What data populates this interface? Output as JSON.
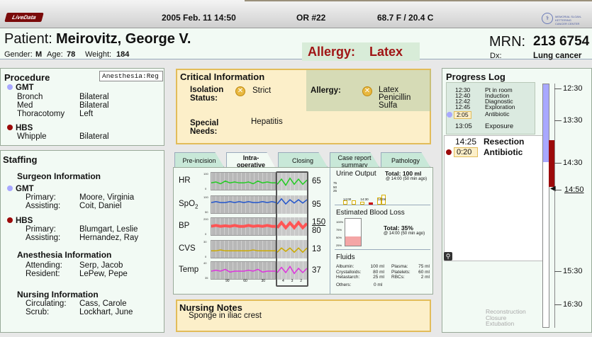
{
  "topbar": {
    "logo_text": "LiveData",
    "datetime": "2005 Feb. 11 14:50",
    "room": "OR #22",
    "temperature": "68.7 F / 20.4 C",
    "institution_line1": "MEMORIAL SLOAN-KETTERING",
    "institution_line2": "CANCER CENTER"
  },
  "patient": {
    "label": "Patient:",
    "name": "Meirovitz, George V.",
    "gender_label": "Gender:",
    "gender": "M",
    "age_label": "Age:",
    "age": "78",
    "weight_label": "Weight:",
    "weight": "184",
    "allergy_label": "Allergy:",
    "allergy_value": "Latex",
    "mrn_label": "MRN:",
    "mrn": "213 6754",
    "dx_label": "Dx:",
    "dx": "Lung cancer"
  },
  "procedure": {
    "title": "Procedure",
    "anesthesia_badge": "Anesthesia:Reg",
    "groups": [
      {
        "code": "GMT",
        "color": "#a8a8ff",
        "rows": [
          [
            "Bronch",
            "Bilateral"
          ],
          [
            "Med",
            "Bilateral"
          ],
          [
            "Thoracotomy",
            "Left"
          ]
        ]
      },
      {
        "code": "HBS",
        "color": "#9c0a0a",
        "rows": [
          [
            "Whipple",
            "Bilateral"
          ]
        ]
      }
    ]
  },
  "staffing": {
    "title": "Staffing",
    "surgeon_title": "Surgeon Information",
    "gmt": {
      "code": "GMT",
      "primary_label": "Primary:",
      "primary": "Moore, Virginia",
      "assisting_label": "Assisting:",
      "assisting": "Coit, Daniel"
    },
    "hbs": {
      "code": "HBS",
      "primary_label": "Primary:",
      "primary": "Blumgart, Leslie",
      "assisting_label": "Assisting:",
      "assisting": "Hernandez, Ray"
    },
    "anesthesia_title": "Anesthesia Information",
    "attending_label": "Attending:",
    "attending": "Serp, Jacob",
    "resident_label": "Resident:",
    "resident": "LePew, Pepe",
    "nursing_title": "Nursing Information",
    "circulating_label": "Circulating:",
    "circulating": "Cass, Carole",
    "scrub_label": "Scrub:",
    "scrub": "Lockhart, June"
  },
  "critical": {
    "title": "Critical Information",
    "isolation_label_1": "Isolation",
    "isolation_label_2": "Status:",
    "isolation_value": "Strict",
    "special_label_1": "Special",
    "special_label_2": "Needs:",
    "special_value": "Hepatitis",
    "allergy_label": "Allergy:",
    "allergies": [
      "Latex",
      "Penicillin",
      "Sulfa"
    ]
  },
  "tabs": [
    {
      "label": "Pre-incision"
    },
    {
      "label": "Intra-operative"
    },
    {
      "label": "Closing"
    },
    {
      "label": "Case report summary"
    },
    {
      "label": "Pathology"
    }
  ],
  "vitals": [
    {
      "label": "HR",
      "value": "65",
      "color": "#22cc22",
      "scale_top": "100",
      "scale_bot": "0"
    },
    {
      "label": "SpO2",
      "value": "95",
      "color": "#2255cc",
      "scale_top": "100",
      "scale_bot": "50"
    },
    {
      "label": "BP",
      "value_top": "150",
      "value_bot": "80",
      "color": "#ff5555",
      "scale_top": "200",
      "scale_bot": "0"
    },
    {
      "label": "CVS",
      "value": "13",
      "color": "#ccaa00",
      "scale_top": "30",
      "scale_bot": "0"
    },
    {
      "label": "Temp",
      "value": "37",
      "color": "#dd33dd",
      "scale_top": "40",
      "scale_bot": "35"
    }
  ],
  "vitals_axis": [
    "90",
    "60",
    "30"
  ],
  "vitals_axis_recent": [
    "4",
    "3",
    "2"
  ],
  "urine": {
    "title": "Urine Output",
    "total_label": "Total: 100 ml",
    "total_note": "@ 14:00 (50 min ago)",
    "y_ticks": [
      "75",
      "50",
      "25"
    ],
    "x_ticks": [
      "14:00",
      "14:30",
      "14:08"
    ]
  },
  "blood_loss": {
    "title": "Estimated Blood Loss",
    "levels": [
      "100%",
      "75%",
      "50%",
      "25%"
    ],
    "total_label": "Total: 35%",
    "total_note": "@ 14:00 (50 min ago)"
  },
  "fluids": {
    "title": "Fluids",
    "col1": [
      [
        "Albumin:",
        "100 ml"
      ],
      [
        "Crystalloids:",
        "80 ml"
      ],
      [
        "Hetastarch:",
        "25 ml"
      ],
      [
        "Others:",
        "0 ml"
      ]
    ],
    "col2": [
      [
        "Plasma:",
        "75 ml"
      ],
      [
        "Platelets:",
        "60 ml"
      ],
      [
        "RBCs:",
        "2 ml"
      ]
    ]
  },
  "nursing_notes": {
    "title": "Nursing Notes",
    "text": "Sponge in iliac crest"
  },
  "progress": {
    "title": "Progress Log",
    "early": [
      [
        "12:30",
        "Pt in room"
      ],
      [
        "12:40",
        "Induction"
      ],
      [
        "12:42",
        "Diagnostic"
      ],
      [
        "12:45",
        "Exploration"
      ],
      [
        "2:05",
        "Antibiotic"
      ],
      [
        "13:05",
        "Exposure"
      ]
    ],
    "current": [
      [
        "14:25",
        "Resection"
      ],
      [
        "0:20",
        "Antibiotic"
      ]
    ],
    "upcoming": [
      "Reconstruction",
      "Closure",
      "Extubation"
    ],
    "ticks": [
      "12:30",
      "13:30",
      "14:30",
      "14:50",
      "15:30",
      "16:30"
    ]
  }
}
